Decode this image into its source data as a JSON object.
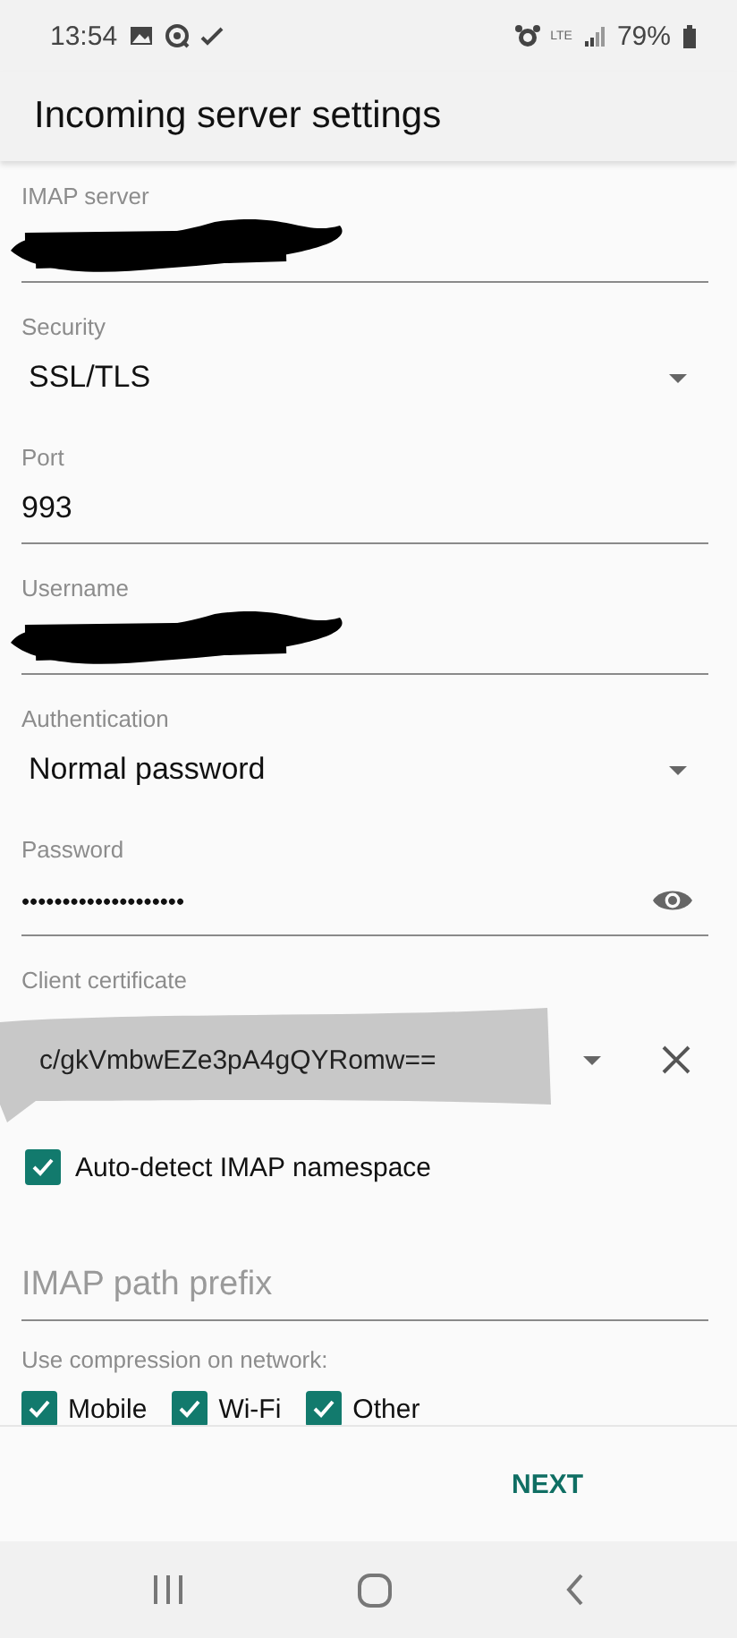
{
  "status_bar": {
    "time": "13:54",
    "network": "LTE",
    "battery": "79%"
  },
  "title": "Incoming server settings",
  "fields": [
    {
      "kind": "text",
      "label": "IMAP server",
      "redacted": true
    },
    {
      "kind": "select",
      "label": "Security",
      "value": "SSL/TLS"
    },
    {
      "kind": "text",
      "label": "Port",
      "value": "993"
    },
    {
      "kind": "text",
      "label": "Username",
      "redacted": true
    },
    {
      "kind": "select",
      "label": "Authentication",
      "value": "Normal password"
    },
    {
      "kind": "password",
      "label": "Password",
      "value": "••••••••••••••••••••"
    },
    {
      "kind": "certificate",
      "label": "Client certificate",
      "value": "c/gkVmbwEZe3pA4gQYRomw==",
      "highlighted": true
    },
    {
      "kind": "checkbox",
      "label": "Auto-detect IMAP namespace",
      "checked": true
    },
    {
      "kind": "text",
      "placeholder": "IMAP path prefix"
    },
    {
      "kind": "checkgroup",
      "label": "Use compression on network:",
      "options": [
        {
          "label": "Mobile",
          "checked": true
        },
        {
          "label": "Wi-Fi",
          "checked": true
        },
        {
          "label": "Other",
          "checked": true
        }
      ]
    }
  ],
  "action": "NEXT"
}
